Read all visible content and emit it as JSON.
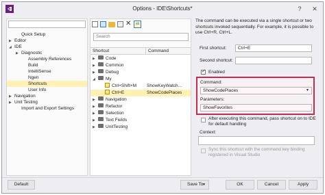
{
  "window": {
    "title": "Options - IDE\\Shortcuts*",
    "help_label": "?",
    "close_label": "✕"
  },
  "left_tree": {
    "items": [
      {
        "label": "Quick Setup",
        "indent": 1,
        "caret": ""
      },
      {
        "label": "Editor",
        "indent": 0,
        "caret": "▶"
      },
      {
        "label": "IDE",
        "indent": 0,
        "caret": "◢"
      },
      {
        "label": "Diagnostic",
        "indent": 1,
        "caret": "▶"
      },
      {
        "label": "Assembly References",
        "indent": 2,
        "caret": ""
      },
      {
        "label": "Build",
        "indent": 2,
        "caret": ""
      },
      {
        "label": "IntelliSense",
        "indent": 2,
        "caret": ""
      },
      {
        "label": "Ngen",
        "indent": 2,
        "caret": ""
      },
      {
        "label": "Shortcuts",
        "indent": 2,
        "caret": "",
        "selected": true
      },
      {
        "label": "User Info",
        "indent": 2,
        "caret": ""
      },
      {
        "label": "Navigation",
        "indent": 0,
        "caret": "▶"
      },
      {
        "label": "Unit Testing",
        "indent": 0,
        "caret": "▶"
      },
      {
        "label": "Import and Export Settings",
        "indent": 1,
        "caret": ""
      }
    ]
  },
  "middle": {
    "search_placeholder": "Search",
    "col_shortcut": "Shortcut",
    "col_command": "Command",
    "rows": [
      {
        "label": "Code",
        "type": "folder",
        "indent": 0,
        "caret": "▶",
        "command": ""
      },
      {
        "label": "Common",
        "type": "folder",
        "indent": 0,
        "caret": "▶",
        "command": ""
      },
      {
        "label": "Debug",
        "type": "folder",
        "indent": 0,
        "caret": "▶",
        "command": ""
      },
      {
        "label": "My",
        "type": "folder",
        "indent": 0,
        "caret": "◢",
        "command": ""
      },
      {
        "label": "Ctrl+Shift+M",
        "type": "cmd",
        "indent": 1,
        "caret": "",
        "command": "ShowKeyWatch..."
      },
      {
        "label": "Ctrl+E",
        "type": "cmd",
        "indent": 1,
        "caret": "",
        "command": "ShowCodePlaces",
        "selected": true
      },
      {
        "label": "Navigation",
        "type": "folder",
        "indent": 0,
        "caret": "▶",
        "command": ""
      },
      {
        "label": "Refactor",
        "type": "folder",
        "indent": 0,
        "caret": "▶",
        "command": ""
      },
      {
        "label": "Selection",
        "type": "folder",
        "indent": 0,
        "caret": "▶",
        "command": ""
      },
      {
        "label": "Text Fields",
        "type": "folder",
        "indent": 0,
        "caret": "▶",
        "command": ""
      },
      {
        "label": "UnitTesting",
        "type": "folder",
        "indent": 0,
        "caret": "▶",
        "command": ""
      }
    ]
  },
  "right": {
    "info": "The command can be executed via a single shortcut or two shortcuts invoked sequentially. For example, it is possible to use Ctrl+R, Ctrl+L.",
    "first_shortcut_label": "First shortcut:",
    "first_shortcut_value": "Ctrl+E",
    "second_shortcut_label": "Second shortcut:",
    "enabled_label": "Enabled",
    "command_label": "Command:",
    "command_value": "ShowCodePlaces",
    "parameters_label": "Parameters:",
    "parameters_value": "ShowFavorites",
    "after_exec_label": "After executing this command, pass shortcut on to IDE for default handling",
    "context_label": "Context:",
    "sync_label": "Sync this shortcut with the command key binding registered in Visual Studio"
  },
  "footer": {
    "default_label": "Default",
    "save_to_label": "Save To",
    "ok_label": "OK",
    "cancel_label": "Cancel",
    "apply_label": "Apply"
  },
  "colors": {
    "accent": "#c62a4f",
    "selection": "#fff0b4",
    "tab_frame": "#68217a"
  }
}
